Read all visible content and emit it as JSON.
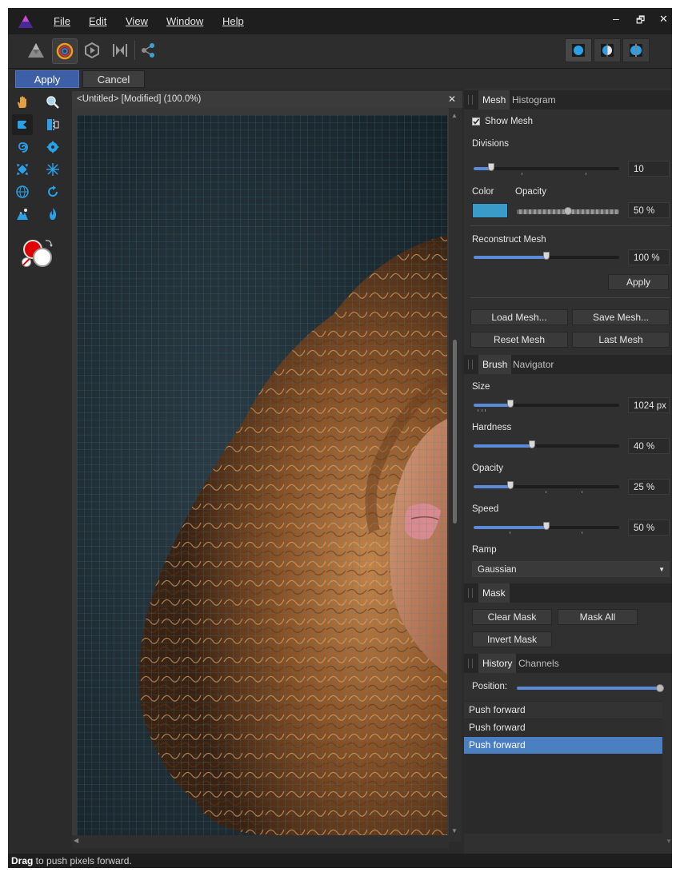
{
  "menubar": {
    "items": [
      "File",
      "Edit",
      "View",
      "Window",
      "Help"
    ],
    "window_controls": [
      "–",
      "🗗",
      "✕"
    ]
  },
  "toolbar": {
    "icons": [
      "persona-photo-icon",
      "liquify-persona-icon",
      "develop-persona-icon",
      "tone-mapping-persona-icon",
      "export-persona-icon"
    ],
    "view_modes": [
      "view-full-icon",
      "view-split-icon",
      "view-mirror-icon"
    ]
  },
  "contextbar": {
    "apply_label": "Apply",
    "cancel_label": "Cancel"
  },
  "document": {
    "tab_title": "<Untitled> [Modified] (100.0%)",
    "close_glyph": "✕"
  },
  "colors": {
    "accent": "#3c5fa8",
    "primary": "#e00000",
    "secondary": "#ffffff",
    "mesh_color": "#3a9ac8",
    "selection": "#4a7fc1"
  },
  "mesh_panel": {
    "tabs": [
      "Mesh",
      "Histogram"
    ],
    "show_mesh_label": "Show Mesh",
    "divisions_label": "Divisions",
    "divisions_value": "10",
    "divisions_fraction": 0.12,
    "color_label": "Color",
    "opacity_label": "Opacity",
    "opacity_value": "50 %",
    "opacity_fraction": 0.5,
    "reconstruct_label": "Reconstruct Mesh",
    "reconstruct_value": "100 %",
    "reconstruct_fraction": 0.5,
    "apply_label": "Apply",
    "load_label": "Load Mesh...",
    "save_label": "Save Mesh...",
    "reset_label": "Reset Mesh",
    "last_label": "Last Mesh"
  },
  "brush_panel": {
    "tabs": [
      "Brush",
      "Navigator"
    ],
    "size_label": "Size",
    "size_value": "1024 px",
    "size_fraction": 0.25,
    "hardness_label": "Hardness",
    "hardness_value": "40 %",
    "hardness_fraction": 0.4,
    "opacity_label": "Opacity",
    "opacity_value": "25 %",
    "opacity_fraction": 0.25,
    "speed_label": "Speed",
    "speed_value": "50 %",
    "speed_fraction": 0.5,
    "ramp_label": "Ramp",
    "ramp_value": "Gaussian"
  },
  "mask_panel": {
    "tabs": [
      "Mask"
    ],
    "clear_label": "Clear Mask",
    "mask_all_label": "Mask All",
    "invert_label": "Invert Mask"
  },
  "history_panel": {
    "tabs": [
      "History",
      "Channels"
    ],
    "position_label": "Position:",
    "position_fraction": 1.0,
    "entries": [
      "Push forward",
      "Push forward",
      "Push forward"
    ]
  },
  "status": {
    "bold": "Drag",
    "text": " to push pixels forward."
  }
}
